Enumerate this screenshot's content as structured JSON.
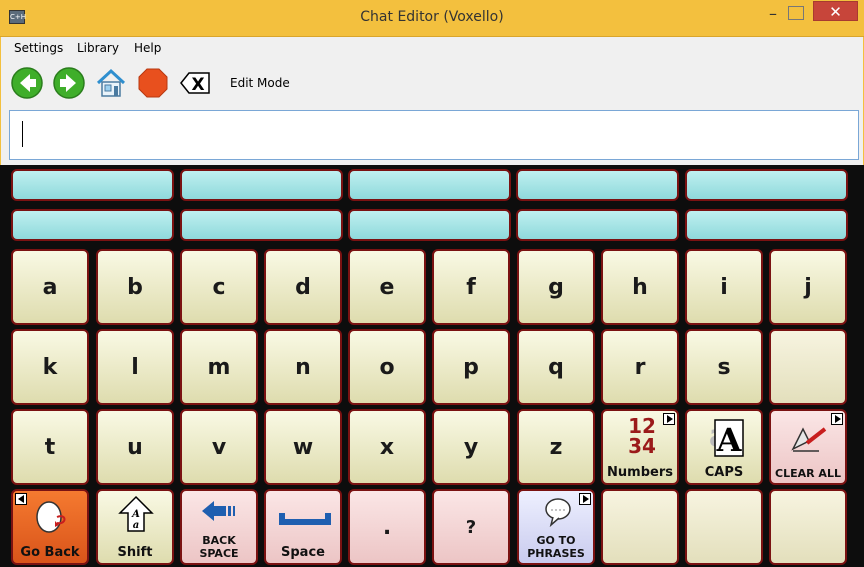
{
  "window": {
    "app_icon_text": "C+H",
    "title": "Chat Editor (Voxello)",
    "minimize": "–",
    "close": "✕"
  },
  "menu": [
    "Settings",
    "Library",
    "Help"
  ],
  "toolbar": {
    "mode_label": "Edit Mode",
    "icons": [
      "back-arrow-icon",
      "forward-arrow-icon",
      "home-icon",
      "stop-icon",
      "delete-word-icon"
    ],
    "delete_glyph": "X"
  },
  "message": {
    "value": ""
  },
  "keys": {
    "row1": [
      "a",
      "b",
      "c",
      "d",
      "e",
      "f",
      "g",
      "h",
      "i",
      "j"
    ],
    "row2": [
      "k",
      "l",
      "m",
      "n",
      "o",
      "p",
      "q",
      "r",
      "s"
    ],
    "row3": [
      "t",
      "u",
      "v",
      "w",
      "x",
      "y",
      "z"
    ],
    "numbers": "Numbers",
    "numbers_glyph_top": "12",
    "numbers_glyph_bottom": "34",
    "caps": "CAPS",
    "caps_glyph": "A",
    "caps_glyph_bg": "a",
    "clear_all": "CLEAR ALL",
    "go_back": "Go Back",
    "shift": "Shift",
    "back_space_1": "BACK",
    "back_space_2": "SPACE",
    "space": "Space",
    "period": ".",
    "question": "?",
    "go_to_1": "GO TO",
    "go_to_2": "PHRASES"
  },
  "colors": {
    "titlebar": "#f3c03e",
    "key": "#f2f0cc",
    "phrase_slot": "#a8e4e6",
    "key_border": "#7a1212",
    "go_back": "#e8642a"
  }
}
